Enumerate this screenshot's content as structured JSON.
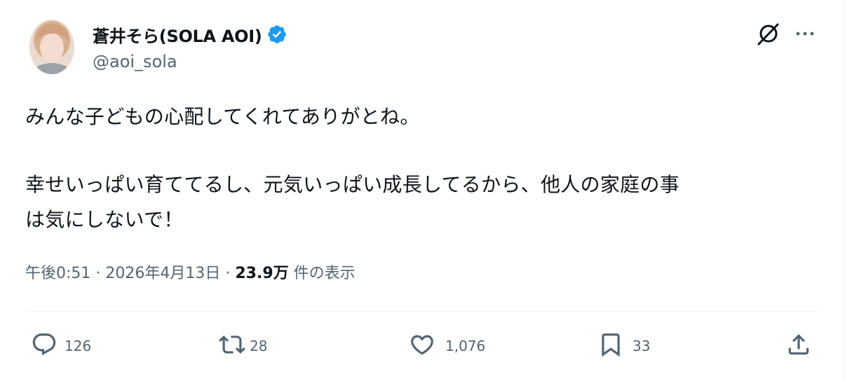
{
  "author": {
    "display_name": "蒼井そら(SOLA AOI)",
    "handle": "@aoi_sola",
    "verified_color": "#1d9bf0"
  },
  "header_icons": {
    "grok": "grok-icon",
    "more": "more-options-icon"
  },
  "tweet": {
    "lines": [
      "みんな子どもの心配してくれてありがとね。",
      "幸せいっぱい育ててるし、元気いっぱい成長してるから、他人の家庭の事",
      "は気にしないで！"
    ]
  },
  "meta": {
    "time": "午後0:51",
    "separator": " · ",
    "date": "2026年4月13日",
    "views_count": "23.9万",
    "views_label": " 件の表示"
  },
  "actions": {
    "replies": "126",
    "reposts": "28",
    "likes": "1,076",
    "bookmarks": "33"
  },
  "colors": {
    "text": "#0f1419",
    "secondary": "#536471",
    "divider": "#eff3f4"
  }
}
